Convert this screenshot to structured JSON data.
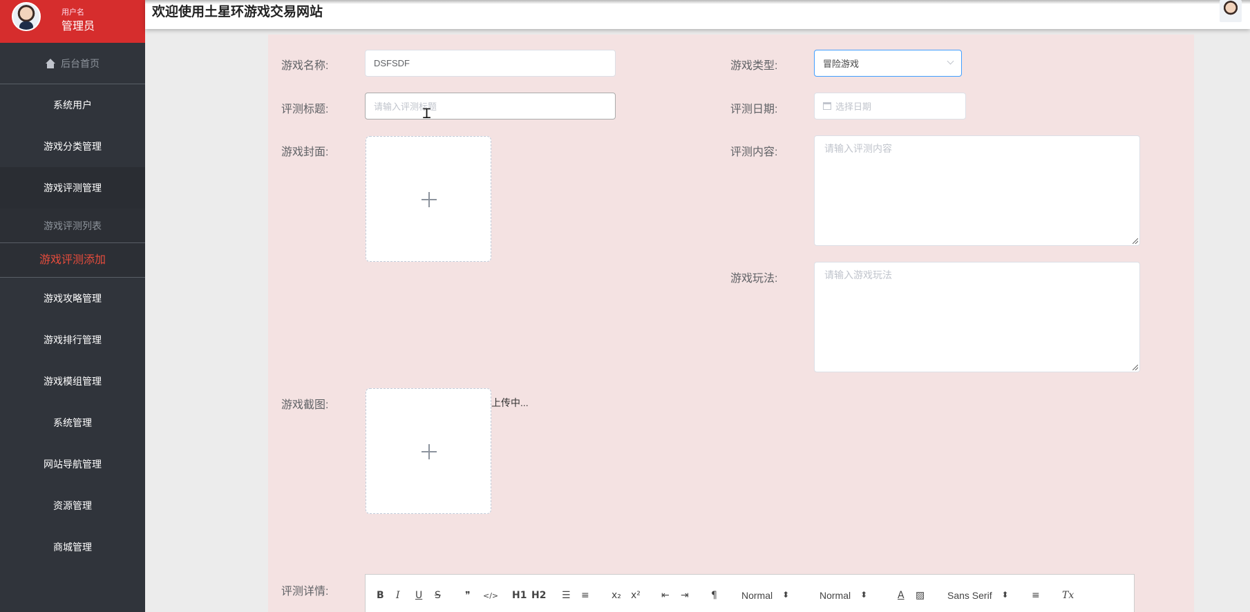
{
  "user": {
    "label": "用户名",
    "role": "管理员"
  },
  "header": {
    "title": "欢迎使用土星环游戏交易网站"
  },
  "sidebar": {
    "home": "后台首页",
    "items": [
      "系统用户",
      "游戏分类管理",
      "游戏评测管理"
    ],
    "submenu": [
      "游戏评测列表",
      "游戏评测添加"
    ],
    "items_after": [
      "游戏攻略管理",
      "游戏排行管理",
      "游戏模组管理",
      "系统管理",
      "网站导航管理",
      "资源管理",
      "商城管理"
    ]
  },
  "form": {
    "game_name": {
      "label": "游戏名称:",
      "value": "DSFSDF"
    },
    "game_type": {
      "label": "游戏类型:",
      "value": "冒险游戏"
    },
    "review_title": {
      "label": "评测标题:",
      "placeholder": "请输入评测标题"
    },
    "review_date": {
      "label": "评测日期:",
      "placeholder": "选择日期"
    },
    "cover": {
      "label": "游戏封面:"
    },
    "review_content": {
      "label": "评测内容:",
      "placeholder": "请输入评测内容"
    },
    "gameplay": {
      "label": "游戏玩法:",
      "placeholder": "请输入游戏玩法"
    },
    "screenshot": {
      "label": "游戏截图:",
      "status": "上传中..."
    },
    "review_detail": {
      "label": "评测详情:"
    }
  },
  "editor": {
    "buttons": [
      "B",
      "I",
      "U",
      "S",
      "❞",
      "</>",
      "H1",
      "H2",
      "☰",
      "≡",
      "x₂",
      "x²",
      "⇤",
      "⇥",
      "¶"
    ],
    "selects": [
      "Normal",
      "Normal",
      "Sans Serif"
    ],
    "extra": [
      "A",
      "▨",
      "≡",
      "Tx"
    ]
  },
  "colors": {
    "accent": "#d62d2d",
    "sidebar": "#30343b",
    "panel": "#f4e2e2",
    "active": "#e74c3c"
  }
}
